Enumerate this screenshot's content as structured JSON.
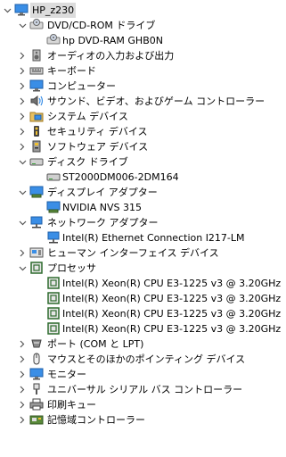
{
  "root": {
    "label": "HP_z230"
  },
  "nodes": [
    {
      "label": "DVD/CD-ROM ドライブ",
      "icon": "optical-drive-icon",
      "expanded": true,
      "level": 1
    },
    {
      "label": "hp DVD-RAM GHB0N",
      "icon": "optical-drive-icon",
      "level": 2
    },
    {
      "label": "オーディオの入力および出力",
      "icon": "speaker-icon",
      "expanded": false,
      "level": 1
    },
    {
      "label": "キーボード",
      "icon": "keyboard-icon",
      "expanded": false,
      "level": 1
    },
    {
      "label": "コンピューター",
      "icon": "computer-icon",
      "expanded": false,
      "level": 1
    },
    {
      "label": "サウンド、ビデオ、およびゲーム コントローラー",
      "icon": "sound-icon",
      "expanded": false,
      "level": 1
    },
    {
      "label": "システム デバイス",
      "icon": "system-folder-icon",
      "expanded": false,
      "level": 1
    },
    {
      "label": "セキュリティ デバイス",
      "icon": "security-key-icon",
      "expanded": false,
      "level": 1
    },
    {
      "label": "ソフトウェア デバイス",
      "icon": "software-device-icon",
      "expanded": false,
      "level": 1
    },
    {
      "label": "ディスク ドライブ",
      "icon": "disk-drive-icon",
      "expanded": true,
      "level": 1
    },
    {
      "label": "ST2000DM006-2DM164",
      "icon": "disk-drive-icon",
      "level": 2
    },
    {
      "label": "ディスプレイ アダプター",
      "icon": "display-adapter-icon",
      "expanded": true,
      "level": 1
    },
    {
      "label": "NVIDIA NVS 315",
      "icon": "display-adapter-icon",
      "level": 2
    },
    {
      "label": "ネットワーク アダプター",
      "icon": "network-adapter-icon",
      "expanded": true,
      "level": 1
    },
    {
      "label": "Intel(R) Ethernet Connection I217-LM",
      "icon": "network-adapter-icon",
      "level": 2
    },
    {
      "label": "ヒューマン インターフェイス デバイス",
      "icon": "hid-icon",
      "expanded": false,
      "level": 1
    },
    {
      "label": "プロセッサ",
      "icon": "processor-icon",
      "expanded": true,
      "level": 1
    },
    {
      "label": "Intel(R) Xeon(R) CPU E3-1225 v3 @ 3.20GHz",
      "icon": "processor-icon",
      "level": 2
    },
    {
      "label": "Intel(R) Xeon(R) CPU E3-1225 v3 @ 3.20GHz",
      "icon": "processor-icon",
      "level": 2
    },
    {
      "label": "Intel(R) Xeon(R) CPU E3-1225 v3 @ 3.20GHz",
      "icon": "processor-icon",
      "level": 2
    },
    {
      "label": "Intel(R) Xeon(R) CPU E3-1225 v3 @ 3.20GHz",
      "icon": "processor-icon",
      "level": 2
    },
    {
      "label": "ポート (COM と LPT)",
      "icon": "port-icon",
      "expanded": false,
      "level": 1
    },
    {
      "label": "マウスとそのほかのポインティング デバイス",
      "icon": "mouse-icon",
      "expanded": false,
      "level": 1
    },
    {
      "label": "モニター",
      "icon": "monitor-icon",
      "expanded": false,
      "level": 1
    },
    {
      "label": "ユニバーサル シリアル バス コントローラー",
      "icon": "usb-icon",
      "expanded": false,
      "level": 1
    },
    {
      "label": "印刷キュー",
      "icon": "printer-icon",
      "expanded": false,
      "level": 1
    },
    {
      "label": "記憶域コントローラー",
      "icon": "storage-controller-icon",
      "expanded": false,
      "level": 1
    }
  ]
}
